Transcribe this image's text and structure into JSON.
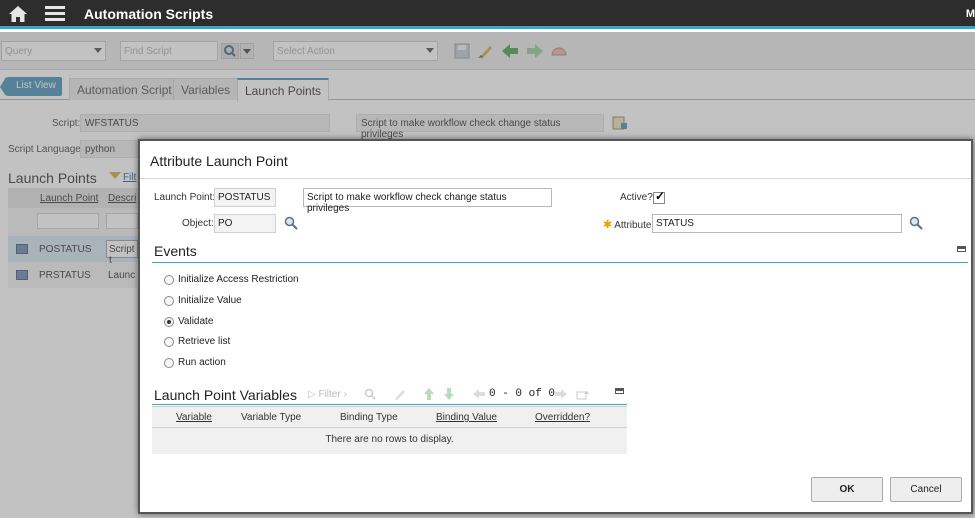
{
  "app": {
    "title": "Automation Scripts",
    "user_initial": "M"
  },
  "toolbar": {
    "query_placeholder": "Query",
    "find_placeholder": "Find Script",
    "action_placeholder": "Select Action"
  },
  "tabs": {
    "list_view": "List View",
    "items": [
      "Automation Script",
      "Variables",
      "Launch Points"
    ],
    "active": "Launch Points"
  },
  "script": {
    "label": "Script:",
    "value": "WFSTATUS",
    "description": "Script to make workflow check change status privileges",
    "language_label": "Script Language:",
    "language_value": "python"
  },
  "launch_points": {
    "title": "Launch Points",
    "filter_label": "Filt",
    "columns": [
      "Launch Point",
      "Descri"
    ],
    "rows": [
      {
        "name": "POSTATUS",
        "desc": "Script t"
      },
      {
        "name": "PRSTATUS",
        "desc": "Launc"
      }
    ]
  },
  "dialog": {
    "title": "Attribute Launch Point",
    "launch_point_label": "Launch Point:",
    "launch_point_value": "POSTATUS",
    "description_value": "Script to make workflow check change status privileges",
    "active_label": "Active?",
    "active_checked": true,
    "object_label": "Object:",
    "object_value": "PO",
    "attribute_label": "Attribute:",
    "attribute_value": "STATUS",
    "events": {
      "title": "Events",
      "options": [
        {
          "label": "Initialize Access Restriction",
          "selected": false
        },
        {
          "label": "Initialize Value",
          "selected": false
        },
        {
          "label": "Validate",
          "selected": true
        },
        {
          "label": "Retrieve list",
          "selected": false
        },
        {
          "label": "Run action",
          "selected": false
        }
      ]
    },
    "variables": {
      "title": "Launch Point Variables",
      "filter_label": "Filter",
      "paging": "0 - 0 of 0",
      "columns": [
        "Variable",
        "Variable Type",
        "Binding Type",
        "Binding Value",
        "Overridden?"
      ],
      "empty_message": "There are no rows to display."
    },
    "ok_label": "OK",
    "cancel_label": "Cancel"
  },
  "colors": {
    "accent": "#3aa8c4",
    "topbar": "#2d2d2d",
    "list_view": "#3a89b5"
  }
}
